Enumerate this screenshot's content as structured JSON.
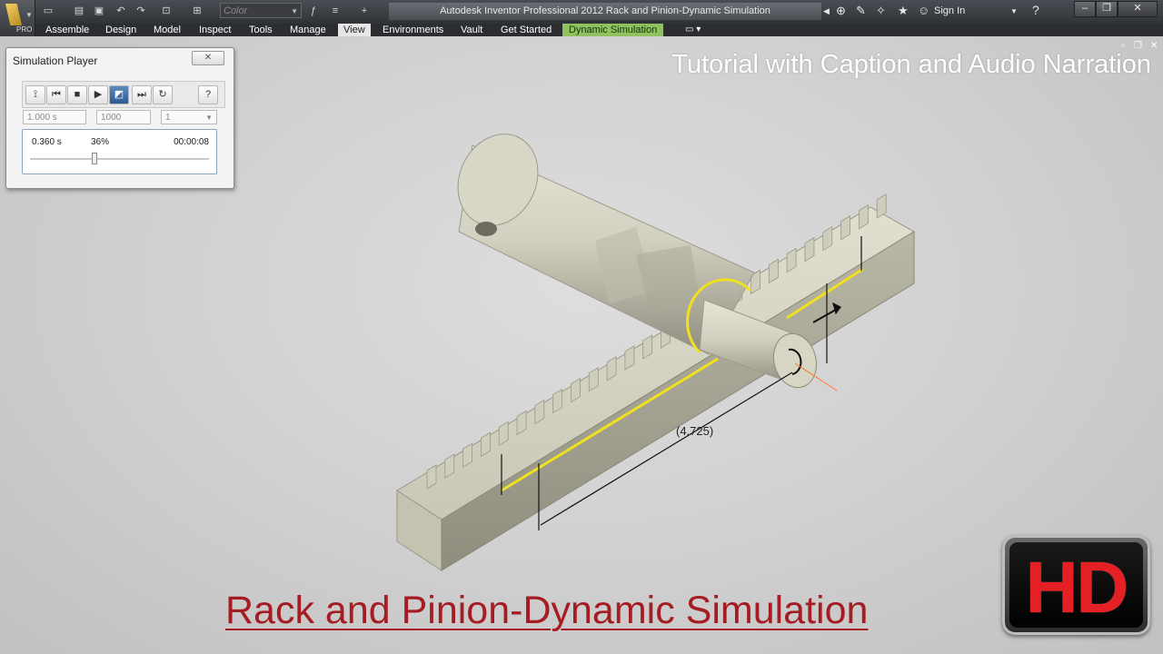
{
  "app": {
    "window_title": "Autodesk Inventor Professional 2012    Rack and Pinion-Dynamic Simulation",
    "app_badge": "PRO",
    "color_dropdown": "Color",
    "sign_in": "Sign In"
  },
  "menu": {
    "items": [
      "Assemble",
      "Design",
      "Model",
      "Inspect",
      "Tools",
      "Manage",
      "View",
      "Environments",
      "Vault",
      "Get Started",
      "Dynamic Simulation"
    ],
    "active": "View",
    "highlighted": "Dynamic Simulation"
  },
  "simulation_player": {
    "title": "Simulation Player",
    "end_time": "1.000 s",
    "images": "1000",
    "filter": "1",
    "current_time": "0.360 s",
    "percent": "36%",
    "elapsed": "00:00:08",
    "progress": 0.36
  },
  "overlay": {
    "caption": "Tutorial with Caption and Audio Narration",
    "bottom_title": "Rack and Pinion-Dynamic Simulation",
    "hd_badge": "HD"
  },
  "model": {
    "dimension": "(4.725)"
  },
  "colors": {
    "title_red": "#a51d22",
    "menu_highlight": "#8fc15e",
    "path_yellow": "#f0e020",
    "part_beige": "#d8d6c6"
  }
}
